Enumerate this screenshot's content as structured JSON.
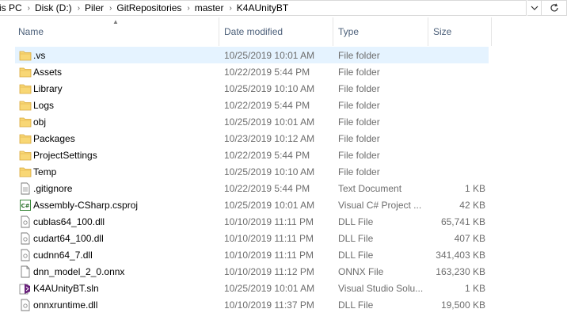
{
  "address": {
    "crumbs": [
      "is PC",
      "Disk (D:)",
      "Piler",
      "GitRepositories",
      "master",
      "K4AUnityBT"
    ],
    "sep": "›"
  },
  "columns": {
    "name": "Name",
    "date": "Date modified",
    "type": "Type",
    "size": "Size"
  },
  "rows": [
    {
      "icon": "folder-icon",
      "name": ".vs",
      "date": "10/25/2019 10:01 AM",
      "type": "File folder",
      "size": ""
    },
    {
      "icon": "folder-icon",
      "name": "Assets",
      "date": "10/22/2019 5:44 PM",
      "type": "File folder",
      "size": ""
    },
    {
      "icon": "folder-icon",
      "name": "Library",
      "date": "10/25/2019 10:10 AM",
      "type": "File folder",
      "size": ""
    },
    {
      "icon": "folder-icon",
      "name": "Logs",
      "date": "10/22/2019 5:44 PM",
      "type": "File folder",
      "size": ""
    },
    {
      "icon": "folder-icon",
      "name": "obj",
      "date": "10/25/2019 10:01 AM",
      "type": "File folder",
      "size": ""
    },
    {
      "icon": "folder-icon",
      "name": "Packages",
      "date": "10/23/2019 10:12 AM",
      "type": "File folder",
      "size": ""
    },
    {
      "icon": "folder-icon",
      "name": "ProjectSettings",
      "date": "10/22/2019 5:44 PM",
      "type": "File folder",
      "size": ""
    },
    {
      "icon": "folder-icon",
      "name": "Temp",
      "date": "10/25/2019 10:10 AM",
      "type": "File folder",
      "size": ""
    },
    {
      "icon": "text-file-icon",
      "name": ".gitignore",
      "date": "10/22/2019 5:44 PM",
      "type": "Text Document",
      "size": "1 KB"
    },
    {
      "icon": "csharp-project-icon",
      "name": "Assembly-CSharp.csproj",
      "date": "10/25/2019 10:01 AM",
      "type": "Visual C# Project ...",
      "size": "42 KB"
    },
    {
      "icon": "dll-file-icon",
      "name": "cublas64_100.dll",
      "date": "10/10/2019 11:11 PM",
      "type": "DLL File",
      "size": "65,741 KB"
    },
    {
      "icon": "dll-file-icon",
      "name": "cudart64_100.dll",
      "date": "10/10/2019 11:11 PM",
      "type": "DLL File",
      "size": "407 KB"
    },
    {
      "icon": "dll-file-icon",
      "name": "cudnn64_7.dll",
      "date": "10/10/2019 11:11 PM",
      "type": "DLL File",
      "size": "341,403 KB"
    },
    {
      "icon": "blank-file-icon",
      "name": "dnn_model_2_0.onnx",
      "date": "10/10/2019 11:12 PM",
      "type": "ONNX File",
      "size": "163,230 KB"
    },
    {
      "icon": "visual-studio-solution-icon",
      "name": "K4AUnityBT.sln",
      "date": "10/25/2019 10:01 AM",
      "type": "Visual Studio Solu...",
      "size": "1 KB"
    },
    {
      "icon": "dll-file-icon",
      "name": "onnxruntime.dll",
      "date": "10/10/2019 11:37 PM",
      "type": "DLL File",
      "size": "19,500 KB"
    }
  ],
  "colors": {
    "selection": "#e5f3ff",
    "folder": "#f8d775",
    "header_text": "#4c607a"
  }
}
